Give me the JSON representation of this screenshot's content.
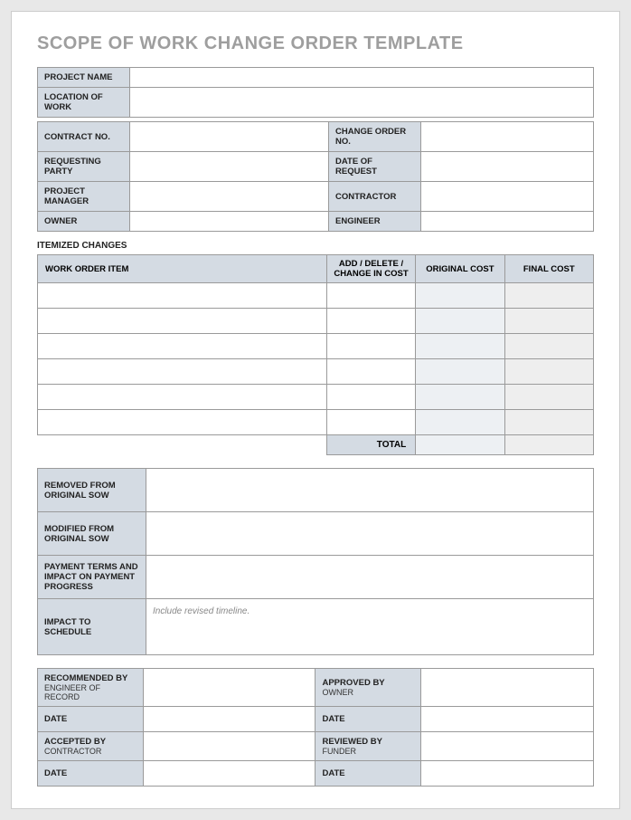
{
  "title": "SCOPE OF WORK CHANGE ORDER TEMPLATE",
  "project_info": {
    "project_name_label": "PROJECT NAME",
    "project_name": "",
    "location_label": "LOCATION OF WORK",
    "location": "",
    "contract_no_label": "CONTRACT NO.",
    "contract_no": "",
    "change_order_no_label": "CHANGE ORDER NO.",
    "change_order_no": "",
    "requesting_party_label": "REQUESTING PARTY",
    "requesting_party": "",
    "date_of_request_label": "DATE OF REQUEST",
    "date_of_request": "",
    "project_manager_label": "PROJECT MANAGER",
    "project_manager": "",
    "contractor_label": "CONTRACTOR",
    "contractor": "",
    "owner_label": "OWNER",
    "owner": "",
    "engineer_label": "ENGINEER",
    "engineer": ""
  },
  "itemized": {
    "section_title": "ITEMIZED CHANGES",
    "headers": {
      "item": "WORK ORDER ITEM",
      "change": "ADD / DELETE / CHANGE IN COST",
      "original": "ORIGINAL COST",
      "final": "FINAL COST"
    },
    "rows": [
      {
        "item": "",
        "change": "",
        "original": "",
        "final": ""
      },
      {
        "item": "",
        "change": "",
        "original": "",
        "final": ""
      },
      {
        "item": "",
        "change": "",
        "original": "",
        "final": ""
      },
      {
        "item": "",
        "change": "",
        "original": "",
        "final": ""
      },
      {
        "item": "",
        "change": "",
        "original": "",
        "final": ""
      },
      {
        "item": "",
        "change": "",
        "original": "",
        "final": ""
      }
    ],
    "total_label": "TOTAL",
    "total_original": "",
    "total_final": ""
  },
  "details": {
    "removed_label": "REMOVED FROM ORIGINAL SOW",
    "removed": "",
    "modified_label": "MODIFIED FROM ORIGINAL SOW",
    "modified": "",
    "payment_label": "PAYMENT TERMS AND IMPACT ON PAYMENT PROGRESS",
    "payment": "",
    "schedule_label": "IMPACT TO SCHEDULE",
    "schedule_placeholder": "Include revised timeline.",
    "schedule": ""
  },
  "signatures": {
    "recommended_label": "RECOMMENDED BY",
    "recommended_sub": "ENGINEER OF RECORD",
    "recommended": "",
    "recommended_date_label": "DATE",
    "recommended_date": "",
    "approved_label": "APPROVED BY",
    "approved_sub": "OWNER",
    "approved": "",
    "approved_date_label": "DATE",
    "approved_date": "",
    "accepted_label": "ACCEPTED BY",
    "accepted_sub": "CONTRACTOR",
    "accepted": "",
    "accepted_date_label": "DATE",
    "accepted_date": "",
    "reviewed_label": "REVIEWED BY",
    "reviewed_sub": "FUNDER",
    "reviewed": "",
    "reviewed_date_label": "DATE",
    "reviewed_date": ""
  }
}
